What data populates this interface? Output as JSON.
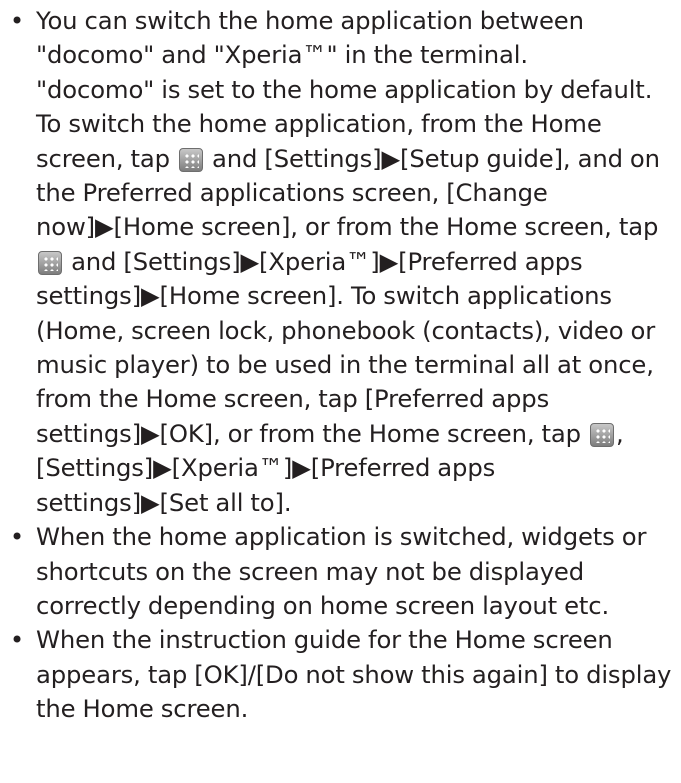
{
  "bullet_symbol": "•",
  "icon": "menu-grid-icon",
  "bullets": [
    {
      "lines": [
        [
          "You can switch the home application between"
        ],
        [
          "\"docomo\" and \"Xperia™\" in the terminal."
        ],
        [
          "\"docomo\" is set to the home application by default."
        ],
        [
          "To switch the home application, from the Home"
        ],
        [
          "screen, tap ",
          "{icon}",
          " and [Settings]▶[Setup guide], and on"
        ],
        [
          "the Preferred applications screen, [Change"
        ],
        [
          "now]▶[Home screen], or from the Home screen, tap"
        ],
        [
          "{icon}",
          " and [Settings]▶[Xperia™]▶[Preferred apps"
        ],
        [
          "settings]▶[Home screen]. To switch applications"
        ],
        [
          "(Home, screen lock, phonebook (contacts), video or"
        ],
        [
          "music player) to be used in the terminal all at once,"
        ],
        [
          "from the Home screen, tap [Preferred apps"
        ],
        [
          "settings]▶[OK], or from the Home screen, tap ",
          "{icon}",
          ","
        ],
        [
          "[Settings]▶[Xperia™]▶[Preferred apps"
        ],
        [
          "settings]▶[Set all to]."
        ]
      ]
    },
    {
      "lines": [
        [
          "When the home application is switched, widgets or"
        ],
        [
          "shortcuts on the screen may not be displayed"
        ],
        [
          "correctly depending on home screen layout etc."
        ]
      ]
    },
    {
      "lines": [
        [
          "When the instruction guide for the Home screen"
        ],
        [
          "appears, tap [OK]/[Do not show this again] to display"
        ],
        [
          "the Home screen."
        ]
      ]
    }
  ]
}
